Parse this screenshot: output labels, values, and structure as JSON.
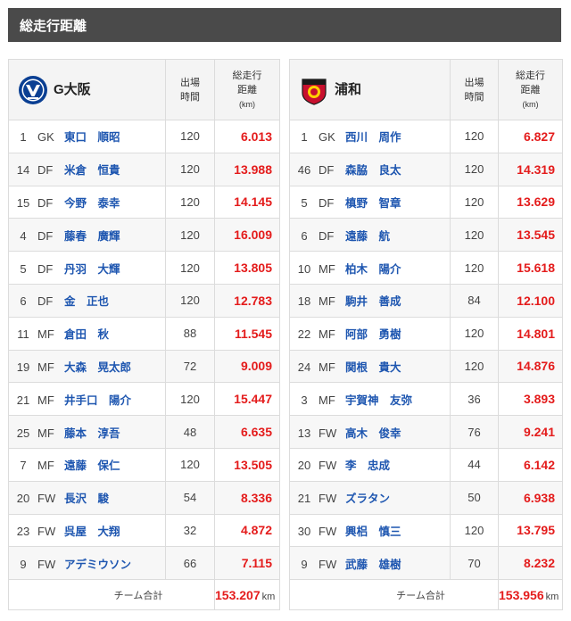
{
  "section_title": "総走行距離",
  "header_labels": {
    "minutes_line1": "出場",
    "minutes_line2": "時間",
    "distance_line1": "総走行",
    "distance_line2": "距離",
    "distance_unit": "(km)"
  },
  "left_team": {
    "name": "G大阪",
    "emblem_icon": "gamba-osaka-emblem",
    "total_label": "チーム合計",
    "total_value": "153.207",
    "total_unit": "km",
    "players": [
      {
        "no": "1",
        "pos": "GK",
        "name": "東口　順昭",
        "min": "120",
        "dist": "6.013"
      },
      {
        "no": "14",
        "pos": "DF",
        "name": "米倉　恒貴",
        "min": "120",
        "dist": "13.988"
      },
      {
        "no": "15",
        "pos": "DF",
        "name": "今野　泰幸",
        "min": "120",
        "dist": "14.145"
      },
      {
        "no": "4",
        "pos": "DF",
        "name": "藤春　廣輝",
        "min": "120",
        "dist": "16.009"
      },
      {
        "no": "5",
        "pos": "DF",
        "name": "丹羽　大輝",
        "min": "120",
        "dist": "13.805"
      },
      {
        "no": "6",
        "pos": "DF",
        "name": "金　正也",
        "min": "120",
        "dist": "12.783"
      },
      {
        "no": "11",
        "pos": "MF",
        "name": "倉田　秋",
        "min": "88",
        "dist": "11.545"
      },
      {
        "no": "19",
        "pos": "MF",
        "name": "大森　晃太郎",
        "min": "72",
        "dist": "9.009"
      },
      {
        "no": "21",
        "pos": "MF",
        "name": "井手口　陽介",
        "min": "120",
        "dist": "15.447"
      },
      {
        "no": "25",
        "pos": "MF",
        "name": "藤本　淳吾",
        "min": "48",
        "dist": "6.635"
      },
      {
        "no": "7",
        "pos": "MF",
        "name": "遠藤　保仁",
        "min": "120",
        "dist": "13.505"
      },
      {
        "no": "20",
        "pos": "FW",
        "name": "長沢　駿",
        "min": "54",
        "dist": "8.336"
      },
      {
        "no": "23",
        "pos": "FW",
        "name": "呉屋　大翔",
        "min": "32",
        "dist": "4.872"
      },
      {
        "no": "9",
        "pos": "FW",
        "name": "アデミウソン",
        "min": "66",
        "dist": "7.115"
      }
    ]
  },
  "right_team": {
    "name": "浦和",
    "emblem_icon": "urawa-reds-emblem",
    "total_label": "チーム合計",
    "total_value": "153.956",
    "total_unit": "km",
    "players": [
      {
        "no": "1",
        "pos": "GK",
        "name": "西川　周作",
        "min": "120",
        "dist": "6.827"
      },
      {
        "no": "46",
        "pos": "DF",
        "name": "森脇　良太",
        "min": "120",
        "dist": "14.319"
      },
      {
        "no": "5",
        "pos": "DF",
        "name": "槙野　智章",
        "min": "120",
        "dist": "13.629"
      },
      {
        "no": "6",
        "pos": "DF",
        "name": "遠藤　航",
        "min": "120",
        "dist": "13.545"
      },
      {
        "no": "10",
        "pos": "MF",
        "name": "柏木　陽介",
        "min": "120",
        "dist": "15.618"
      },
      {
        "no": "18",
        "pos": "MF",
        "name": "駒井　善成",
        "min": "84",
        "dist": "12.100"
      },
      {
        "no": "22",
        "pos": "MF",
        "name": "阿部　勇樹",
        "min": "120",
        "dist": "14.801"
      },
      {
        "no": "24",
        "pos": "MF",
        "name": "関根　貴大",
        "min": "120",
        "dist": "14.876"
      },
      {
        "no": "3",
        "pos": "MF",
        "name": "宇賀神　友弥",
        "min": "36",
        "dist": "3.893"
      },
      {
        "no": "13",
        "pos": "FW",
        "name": "高木　俊幸",
        "min": "76",
        "dist": "9.241"
      },
      {
        "no": "20",
        "pos": "FW",
        "name": "李　忠成",
        "min": "44",
        "dist": "6.142"
      },
      {
        "no": "21",
        "pos": "FW",
        "name": "ズラタン",
        "min": "50",
        "dist": "6.938"
      },
      {
        "no": "30",
        "pos": "FW",
        "name": "興梠　慎三",
        "min": "120",
        "dist": "13.795"
      },
      {
        "no": "9",
        "pos": "FW",
        "name": "武藤　雄樹",
        "min": "70",
        "dist": "8.232"
      }
    ]
  },
  "colors": {
    "header_bg": "#4a4a4a",
    "player_link": "#1e56b0",
    "distance": "#e41c1c"
  }
}
